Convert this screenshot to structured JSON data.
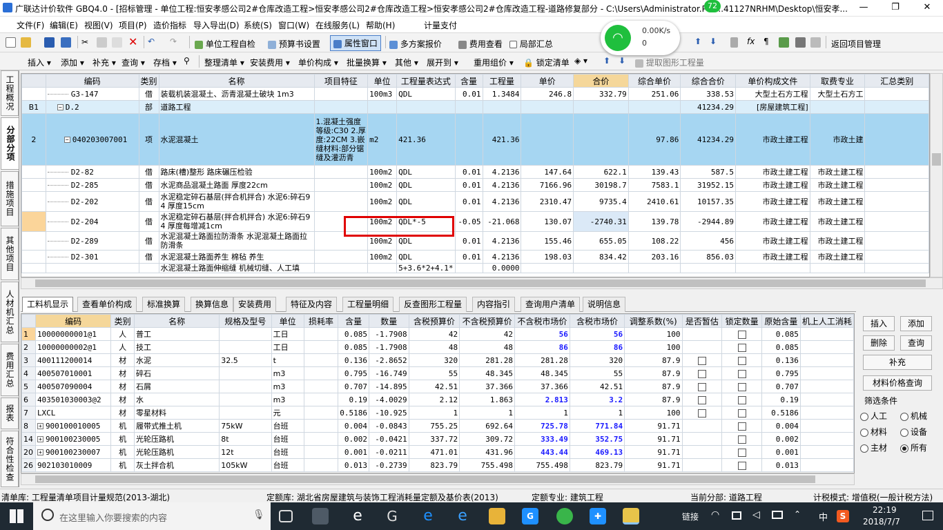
{
  "title": "广联达计价软件 GBQ4.0 - [招标管理 - 单位工程:恒安孝感公司2#仓库改造工程>恒安孝感公司2#仓库改造工程>恒安孝感公司2#仓库改造工程-道路修复部分 - C:\\Users\\Administrator.PC-...41127NRHM\\Desktop\\恒安孝...",
  "menu": [
    "文件(F)",
    "编辑(E)",
    "视图(V)",
    "项目(P)",
    "造价指标",
    "导入导出(D)",
    "系统(S)",
    "窗口(W)",
    "在线服务(L)",
    "帮助(H)",
    "计量支付"
  ],
  "toolbar1": {
    "check": "单位工程自检",
    "preset": "预算书设置",
    "attr": "属性窗口",
    "multi": "多方案报价",
    "fee": "费用查看",
    "local": "局部汇总",
    "back": "返回项目管理"
  },
  "toolbar2": {
    "insert": "插入",
    "add": "添加",
    "supp": "补充",
    "query": "查询",
    "store": "存档",
    "tidy": "整理清单",
    "install": "安装费用",
    "unit": "单价构成",
    "batch": "批量换算",
    "other": "其他",
    "expand": "展开到",
    "reuse": "重用组价",
    "lock": "锁定清单",
    "extract": "提取图形工程量"
  },
  "lefttabs": [
    "工程概况",
    "分部分项",
    "措施项目",
    "其他项目",
    "人材机汇总",
    "费用汇总",
    "报表",
    "符合性检查"
  ],
  "upper": {
    "headers": [
      "",
      "编码",
      "类别",
      "名称",
      "项目特征",
      "单位",
      "工程量表达式",
      "含量",
      "工程量",
      "单价",
      "合价",
      "综合单价",
      "综合合价",
      "单价构成文件",
      "取费专业",
      "汇总类别"
    ],
    "rows": [
      {
        "n": "",
        "code": "G3-147",
        "type": "借",
        "name": "装载机装混凝土、沥青混凝土破块 1m3",
        "feat": "",
        "unit": "100m3",
        "expr": "QDL",
        "qty": "0.01",
        "amt": "1.3484",
        "price": "246.8",
        "total": "332.79",
        "cp": "251.06",
        "ct": "338.53",
        "file": "大型土石方工程",
        "major": "大型土石方工"
      },
      {
        "n": "B1",
        "code": "D.2",
        "type": "部",
        "name": "道路工程",
        "feat": "",
        "unit": "",
        "expr": "",
        "qty": "",
        "amt": "",
        "price": "",
        "total": "",
        "cp": "",
        "ct": "41234.29",
        "file": "[房屋建筑工程]",
        "major": ""
      },
      {
        "n": "2",
        "code": "040203007001",
        "type": "项",
        "name": "水泥混凝土",
        "feat": "1.混凝土强度等级:C30 2.厚度:22CM 3.嵌缝材料:部分锯缝及灌沥青",
        "unit": "m2",
        "expr": "421.36",
        "qty": "",
        "amt": "421.36",
        "price": "",
        "total": "",
        "cp": "97.86",
        "ct": "41234.29",
        "file": "市政土建工程",
        "major": "市政土建"
      },
      {
        "n": "",
        "code": "D2-82",
        "type": "借",
        "name": "路床(槽)整形 路床碾压检验",
        "feat": "",
        "unit": "100m2",
        "expr": "QDL",
        "qty": "0.01",
        "amt": "4.2136",
        "price": "147.64",
        "total": "622.1",
        "cp": "139.43",
        "ct": "587.5",
        "file": "市政土建工程",
        "major": "市政土建工程"
      },
      {
        "n": "",
        "code": "D2-285",
        "type": "借",
        "name": "水泥商品混凝土路面 厚度22cm",
        "feat": "",
        "unit": "100m2",
        "expr": "QDL",
        "qty": "0.01",
        "amt": "4.2136",
        "price": "7166.96",
        "total": "30198.7",
        "cp": "7583.1",
        "ct": "31952.15",
        "file": "市政土建工程",
        "major": "市政土建工程"
      },
      {
        "n": "",
        "code": "D2-202",
        "type": "借",
        "name": "水泥稳定碎石基层(拌合机拌合) 水泥6:碎石94 厚度15cm",
        "feat": "",
        "unit": "100m2",
        "expr": "QDL",
        "qty": "0.01",
        "amt": "4.2136",
        "price": "2310.47",
        "total": "9735.4",
        "cp": "2410.61",
        "ct": "10157.35",
        "file": "市政土建工程",
        "major": "市政土建工程"
      },
      {
        "n": "",
        "code": "D2-204",
        "type": "借",
        "name": "水泥稳定碎石基层(拌合机拌合) 水泥6:碎石94 厚度每增减1cm",
        "feat": "",
        "unit": "100m2",
        "expr": "QDL*-5",
        "qty": "-0.05",
        "amt": "-21.068",
        "price": "130.07",
        "total": "-2740.31",
        "cp": "139.78",
        "ct": "-2944.89",
        "file": "市政土建工程",
        "major": "市政土建工程"
      },
      {
        "n": "",
        "code": "D2-289",
        "type": "借",
        "name": "水泥混凝土路面拉防滑条 水泥混凝土路面拉防滑条",
        "feat": "",
        "unit": "100m2",
        "expr": "QDL",
        "qty": "0.01",
        "amt": "4.2136",
        "price": "155.46",
        "total": "655.05",
        "cp": "108.22",
        "ct": "456",
        "file": "市政土建工程",
        "major": "市政土建工程"
      },
      {
        "n": "",
        "code": "D2-301",
        "type": "借",
        "name": "水泥混凝土路面养生 棉毡 养生",
        "feat": "",
        "unit": "100m2",
        "expr": "QDL",
        "qty": "0.01",
        "amt": "4.2136",
        "price": "198.03",
        "total": "834.42",
        "cp": "203.16",
        "ct": "856.03",
        "file": "市政土建工程",
        "major": "市政土建工程"
      },
      {
        "n": "",
        "code": "",
        "type": "",
        "name": "水泥混凝土路面伸缩缝 机械切缝、人工填",
        "feat": "",
        "unit": "",
        "expr": "5+3.6*2+4.1*",
        "qty": "",
        "amt": "0.0000",
        "price": "",
        "total": "",
        "cp": "",
        "ct": "",
        "file": "",
        "major": ""
      }
    ]
  },
  "lowertabs": [
    "工料机显示",
    "查看单价构成",
    "标准换算",
    "换算信息",
    "安装费用",
    "特征及内容",
    "工程量明细",
    "反查图形工程量",
    "内容指引",
    "查询用户清单",
    "说明信息"
  ],
  "lower": {
    "headers": [
      "",
      "编码",
      "类别",
      "名称",
      "规格及型号",
      "单位",
      "损耗率",
      "含量",
      "数量",
      "含税预算价",
      "不含税预算价",
      "不含税市场价",
      "含税市场价",
      "调整系数(%)",
      "是否暂估",
      "锁定数量",
      "原始含量",
      "机上人工消耗"
    ],
    "rows": [
      {
        "n": "1",
        "plus": false,
        "code": "10000000001@1",
        "type": "人",
        "name": "普工",
        "spec": "",
        "unit": "工日",
        "loss": "",
        "qty": "0.085",
        "num": "-1.7908",
        "p1": "42",
        "p2": "42",
        "p3": "56",
        "p4": "56",
        "adj": "100",
        "est": false,
        "lock": true,
        "orig": "0.085"
      },
      {
        "n": "2",
        "plus": false,
        "code": "10000000002@1",
        "type": "人",
        "name": "技工",
        "spec": "",
        "unit": "工日",
        "loss": "",
        "qty": "0.085",
        "num": "-1.7908",
        "p1": "48",
        "p2": "48",
        "p3": "86",
        "p4": "86",
        "adj": "100",
        "est": false,
        "lock": true,
        "orig": "0.085"
      },
      {
        "n": "3",
        "plus": false,
        "code": "400111200014",
        "type": "材",
        "name": "水泥",
        "spec": "32.5",
        "unit": "t",
        "loss": "",
        "qty": "0.136",
        "num": "-2.8652",
        "p1": "320",
        "p2": "281.28",
        "p3": "281.28",
        "p4": "320",
        "adj": "87.9",
        "est": true,
        "lock": true,
        "orig": "0.136"
      },
      {
        "n": "4",
        "plus": false,
        "code": "400507010001",
        "type": "材",
        "name": "碎石",
        "spec": "",
        "unit": "m3",
        "loss": "",
        "qty": "0.795",
        "num": "-16.749",
        "p1": "55",
        "p2": "48.345",
        "p3": "48.345",
        "p4": "55",
        "adj": "87.9",
        "est": true,
        "lock": true,
        "orig": "0.795"
      },
      {
        "n": "5",
        "plus": false,
        "code": "400507090004",
        "type": "材",
        "name": "石屑",
        "spec": "",
        "unit": "m3",
        "loss": "",
        "qty": "0.707",
        "num": "-14.895",
        "p1": "42.51",
        "p2": "37.366",
        "p3": "37.366",
        "p4": "42.51",
        "adj": "87.9",
        "est": true,
        "lock": true,
        "orig": "0.707"
      },
      {
        "n": "6",
        "plus": false,
        "code": "403501030003@2",
        "type": "材",
        "name": "水",
        "spec": "",
        "unit": "m3",
        "loss": "",
        "qty": "0.19",
        "num": "-4.0029",
        "p1": "2.12",
        "p2": "1.863",
        "p3": "2.813",
        "p4": "3.2",
        "adj": "87.9",
        "est": true,
        "lock": true,
        "orig": "0.19"
      },
      {
        "n": "7",
        "plus": false,
        "code": "LXCL",
        "type": "材",
        "name": "零星材料",
        "spec": "",
        "unit": "元",
        "loss": "",
        "qty": "0.5186",
        "num": "-10.925",
        "p1": "1",
        "p2": "1",
        "p3": "1",
        "p4": "1",
        "adj": "100",
        "est": true,
        "lock": true,
        "orig": "0.5186"
      },
      {
        "n": "8",
        "plus": true,
        "code": "900100010005",
        "type": "机",
        "name": "履带式推土机",
        "spec": "75kW",
        "unit": "台班",
        "loss": "",
        "qty": "0.004",
        "num": "-0.0843",
        "p1": "755.25",
        "p2": "692.64",
        "p3": "725.78",
        "p4": "771.84",
        "adj": "91.71",
        "est": false,
        "lock": true,
        "orig": "0.004"
      },
      {
        "n": "14",
        "plus": true,
        "code": "900100230005",
        "type": "机",
        "name": "光轮压路机",
        "spec": "8t",
        "unit": "台班",
        "loss": "",
        "qty": "0.002",
        "num": "-0.0421",
        "p1": "337.72",
        "p2": "309.72",
        "p3": "333.49",
        "p4": "352.75",
        "adj": "91.71",
        "est": false,
        "lock": true,
        "orig": "0.002"
      },
      {
        "n": "20",
        "plus": true,
        "code": "900100230007",
        "type": "机",
        "name": "光轮压路机",
        "spec": "12t",
        "unit": "台班",
        "loss": "",
        "qty": "0.001",
        "num": "-0.0211",
        "p1": "471.01",
        "p2": "431.96",
        "p3": "443.44",
        "p4": "469.13",
        "adj": "91.71",
        "est": false,
        "lock": true,
        "orig": "0.001"
      },
      {
        "n": "26",
        "plus": false,
        "code": "902103010009",
        "type": "机",
        "name": "灰土拌合机",
        "spec": "105kW",
        "unit": "台班",
        "loss": "",
        "qty": "0.013",
        "num": "-0.2739",
        "p1": "823.79",
        "p2": "755.498",
        "p3": "755.498",
        "p4": "823.79",
        "adj": "91.71",
        "est": false,
        "lock": true,
        "orig": "0.013"
      }
    ]
  },
  "rpanel": {
    "insert": "插入",
    "add": "添加",
    "delete": "删除",
    "query": "查询",
    "supp": "补充",
    "mpq": "材料价格查询",
    "filter": "筛选条件",
    "r1": "人工",
    "r2": "机械",
    "r3": "材料",
    "r4": "设备",
    "r5": "主材",
    "r6": "所有"
  },
  "status": {
    "s1": "清单库: 工程量清单项目计量规范(2013-湖北)",
    "s2": "定额库: 湖北省房屋建筑与装饰工程消耗量定额及基价表(2013)",
    "s3": "定额专业: 建筑工程",
    "s4": "当前分部: 道路工程",
    "s5": "计税模式: 增值税(一般计税方法)"
  },
  "taskbar": {
    "search": "在这里输入你要搜索的内容",
    "link": "链接",
    "lang": "中",
    "time": "22:19",
    "date": "2018/7/7"
  },
  "wifi": {
    "speed1": "0.00K/s",
    "speed2": "0",
    "badge": "72"
  },
  "colors": {
    "selrow": "#a6d6f2",
    "header": "#e6eaf0",
    "highlight": "#f5d79a",
    "redbox": "#e00000",
    "blue": "#1a1aff"
  }
}
